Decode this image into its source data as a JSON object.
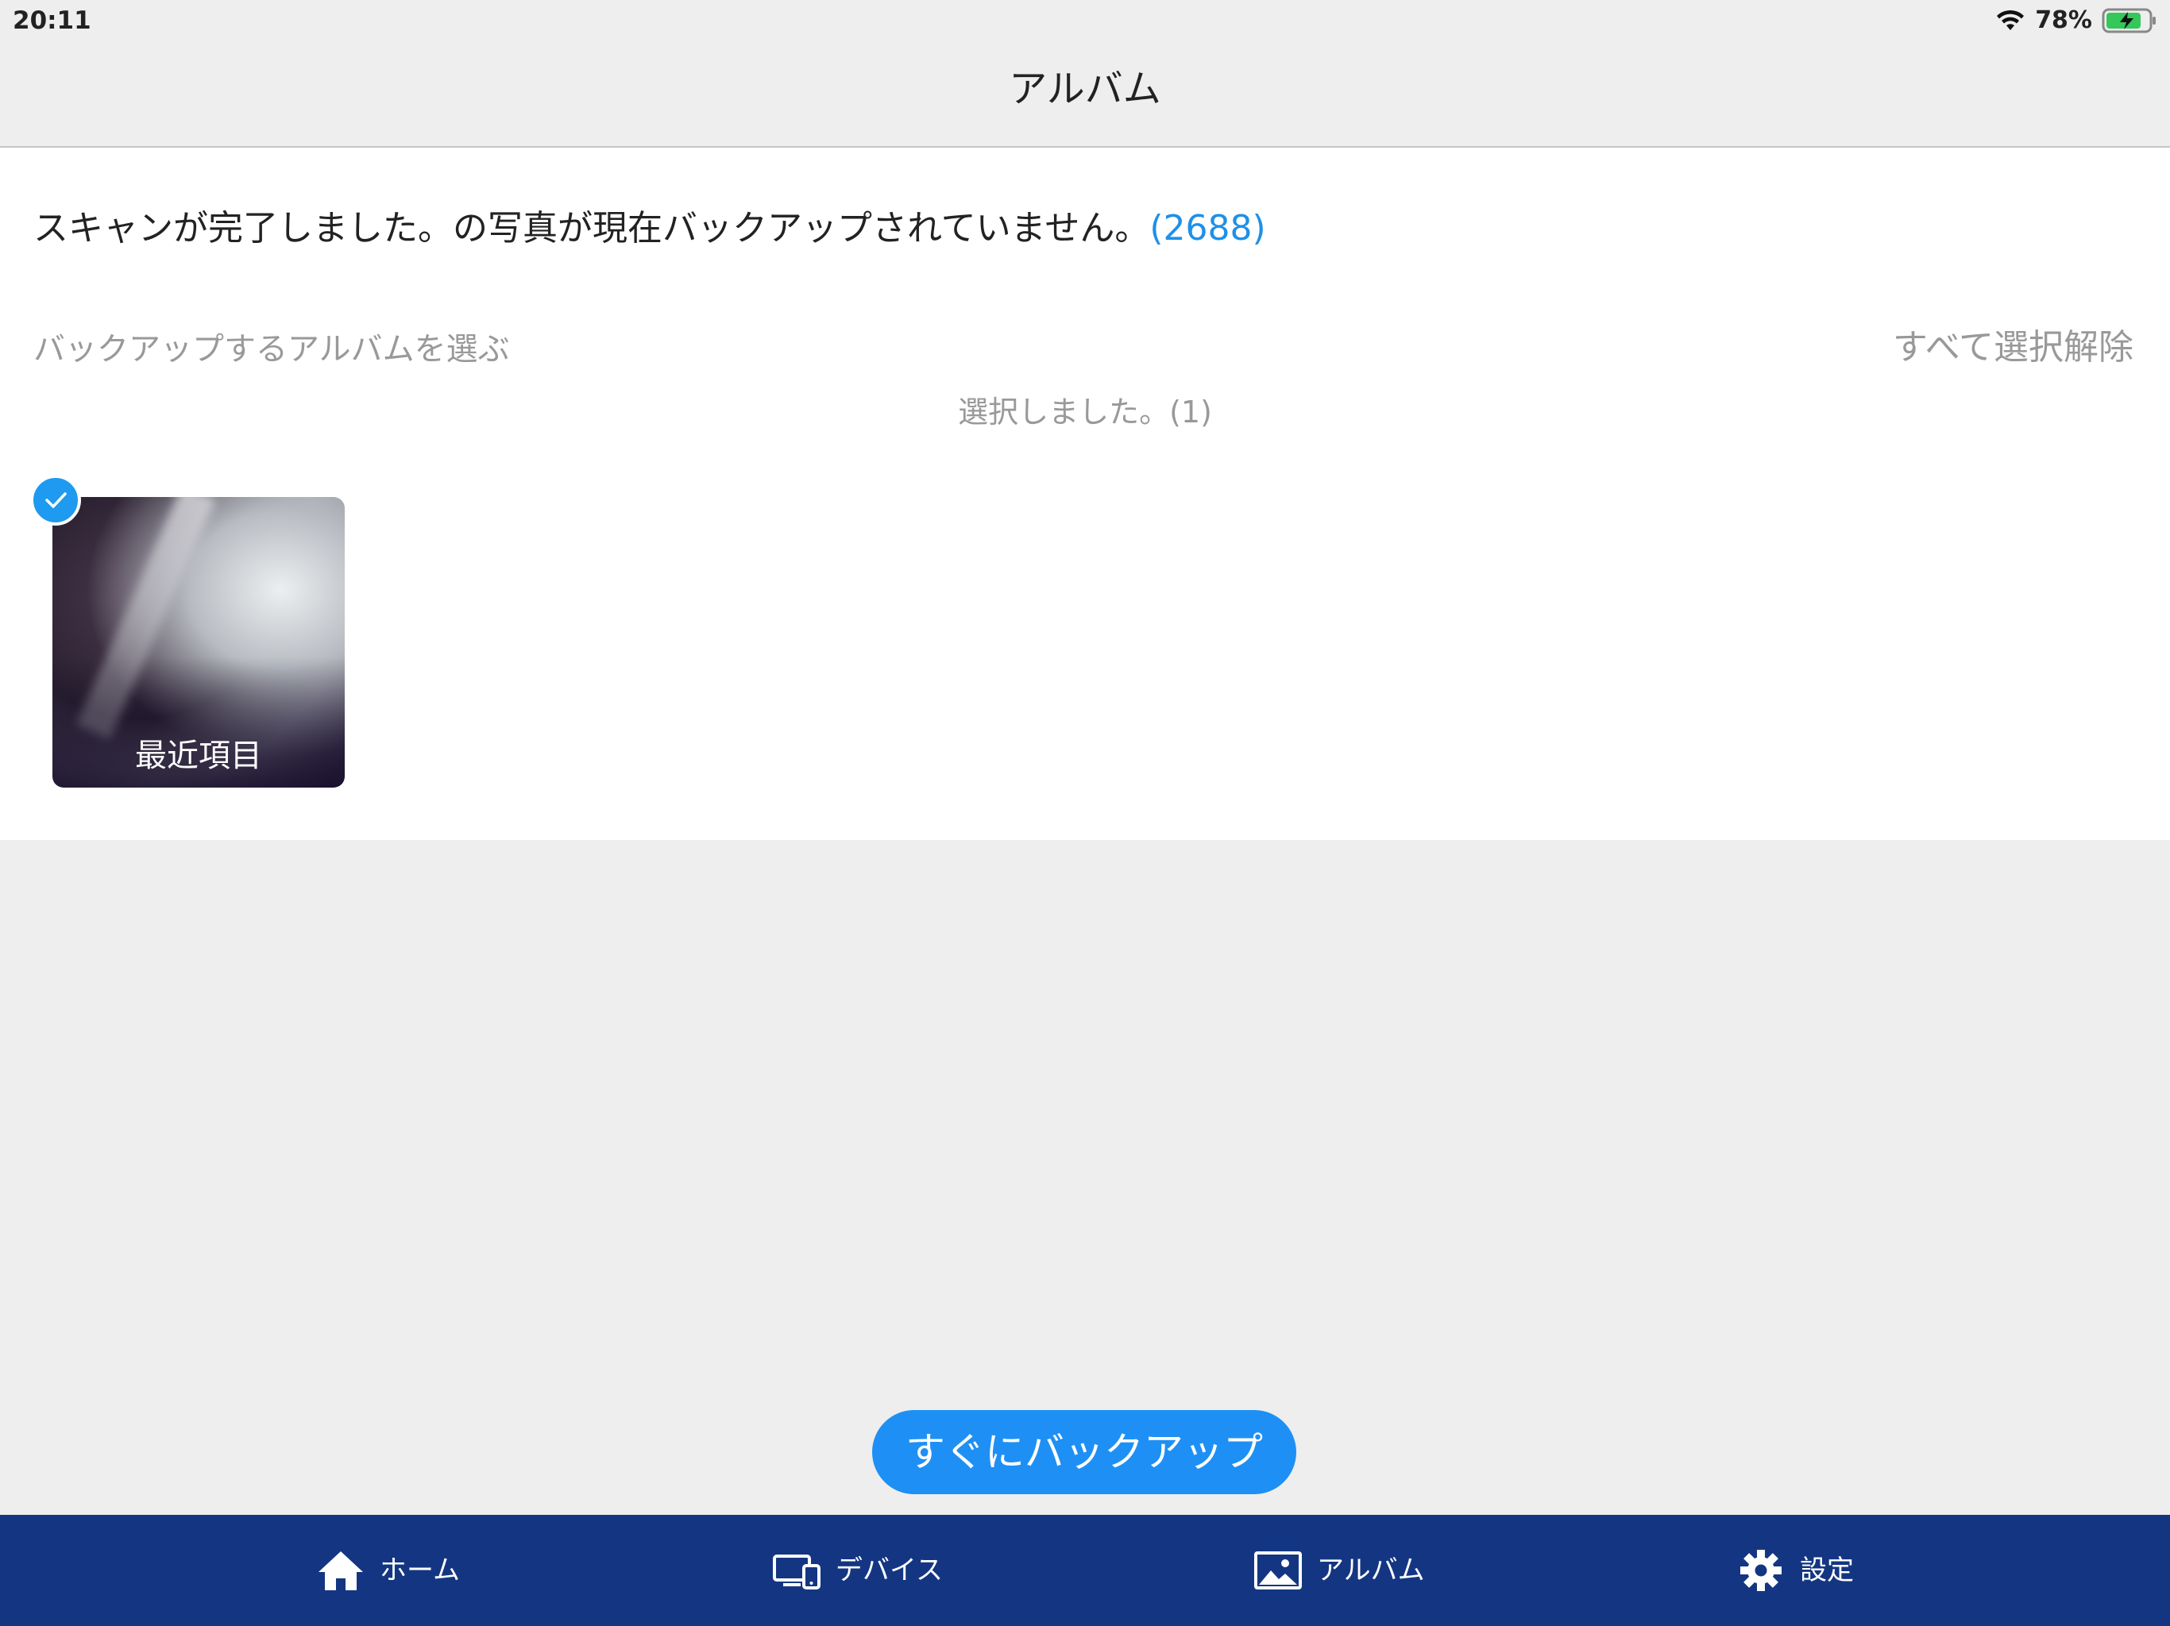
{
  "status_bar": {
    "time": "20:11",
    "battery": "78%",
    "icons": [
      "wifi-icon",
      "battery-charging-icon"
    ]
  },
  "header": {
    "title": "アルバム"
  },
  "main": {
    "scan_message": "スキャンが完了しました。の写真が現在バックアップされていません。",
    "scan_count": "(2688)",
    "choose_label": "バックアップするアルバムを選ぶ",
    "deselect_all": "すべて選択解除",
    "selected_count": "選択しました。(1)",
    "albums": [
      {
        "label": "最近項目",
        "selected": true
      }
    ]
  },
  "backup_button": {
    "label": "すぐにバックアップ"
  },
  "tab_bar": {
    "tabs": [
      {
        "label": "ホーム",
        "icon": "home-icon"
      },
      {
        "label": "デバイス",
        "icon": "devices-icon"
      },
      {
        "label": "アルバム",
        "icon": "album-image-icon"
      },
      {
        "label": "設定",
        "icon": "gear-icon"
      }
    ]
  },
  "colors": {
    "accent_blue": "#1e90f5",
    "tab_bar_navy": "#143682",
    "background_gray": "#eeeeee",
    "muted_text": "#999999"
  }
}
